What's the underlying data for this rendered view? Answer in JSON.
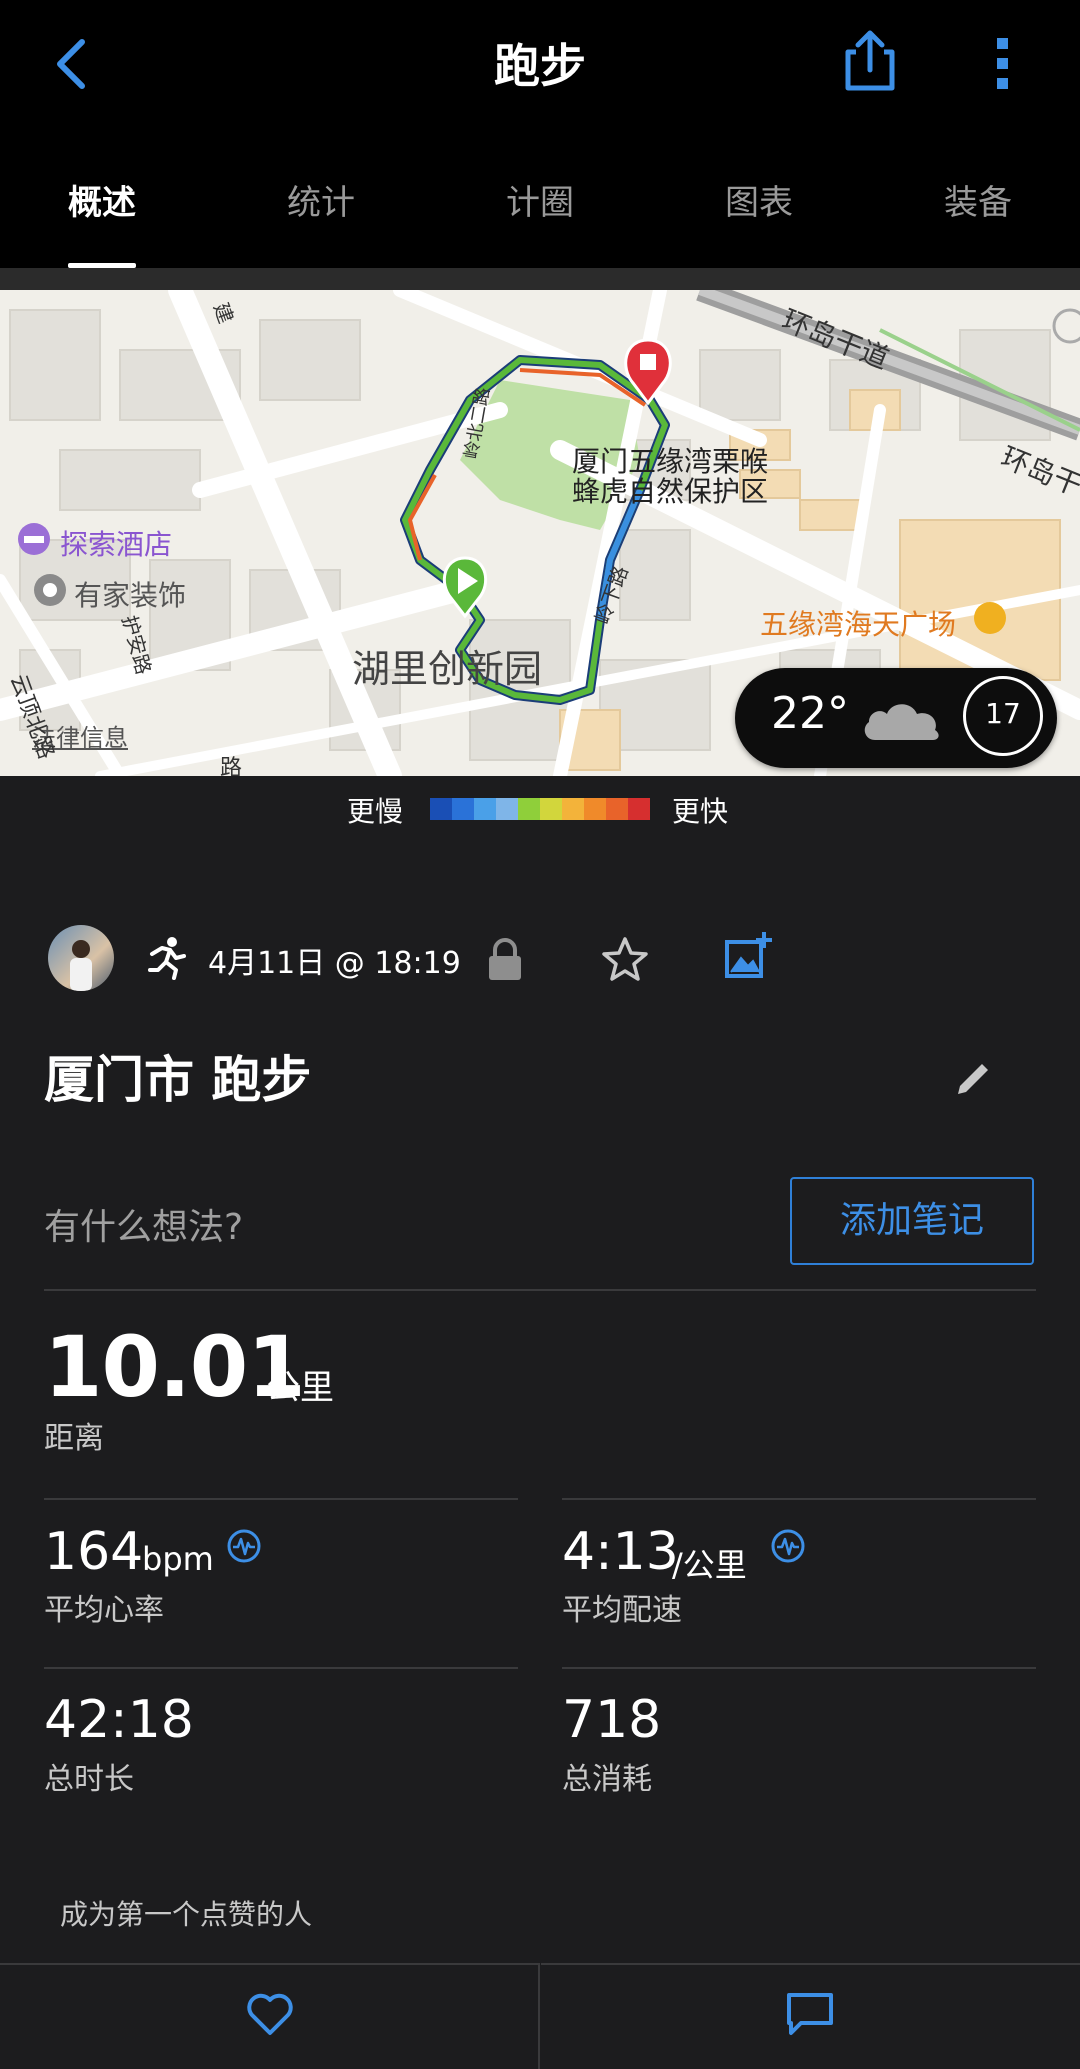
{
  "header": {
    "title": "跑步"
  },
  "tabs": [
    {
      "label": "概述"
    },
    {
      "label": "统计"
    },
    {
      "label": "计圈"
    },
    {
      "label": "图表"
    },
    {
      "label": "装备"
    }
  ],
  "map": {
    "labels": {
      "ring_road_1": "环岛干道",
      "ring_road_2": "环岛干",
      "reserve_line1": "厦门五缘湾栗喉",
      "reserve_line2": "蜂虎自然保护区",
      "hotel": "探索酒店",
      "decor": "有家装饰",
      "plaza": "五缘湾海天广场",
      "park": "湖里创新园",
      "legal": "法律信息",
      "road_hu_an": "护安路",
      "road_yunding": "云顶北路",
      "road_lingxia": "岭下路",
      "road_jian": "建",
      "road_bei": "路",
      "road_yu": "岭北二路"
    },
    "weather": {
      "temperature": "22°",
      "wind_badge": "17"
    }
  },
  "legend": {
    "slower": "更慢",
    "faster": "更快",
    "colors": [
      "#1a4fb5",
      "#2a72d8",
      "#4aa0e8",
      "#7fb5e8",
      "#8fcf3a",
      "#d2d63c",
      "#f3b33a",
      "#f08a2a",
      "#e8632a",
      "#d62f2f"
    ]
  },
  "activity": {
    "date": "4月11日 @ 18:19",
    "title": "厦门市 跑步",
    "thoughts_placeholder": "有什么想法?",
    "add_note_label": "添加笔记"
  },
  "stats": {
    "distance": {
      "value": "10.01",
      "unit": "公里",
      "label": "距离"
    },
    "avg_hr": {
      "value": "164",
      "unit": "bpm",
      "label": "平均心率"
    },
    "avg_pace": {
      "value": "4:13",
      "unit": "/公里",
      "label": "平均配速"
    },
    "total_time": {
      "value": "42:18",
      "label": "总时长"
    },
    "calories": {
      "value": "718",
      "label": "总消耗"
    }
  },
  "social": {
    "first_like": "成为第一个点赞的人"
  },
  "colors": {
    "accent": "#2f80d8",
    "background": "#1c1c1e",
    "header": "#000000"
  }
}
